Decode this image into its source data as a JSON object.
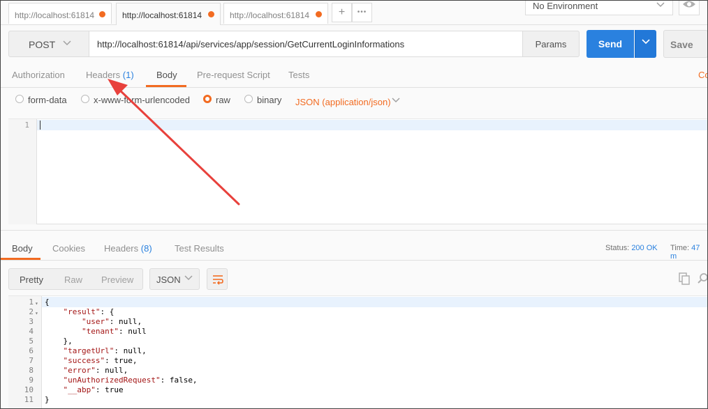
{
  "tabs": [
    {
      "label": "http://localhost:61814",
      "active": false,
      "unsaved": true
    },
    {
      "label": "http://localhost:61814",
      "active": true,
      "unsaved": true
    },
    {
      "label": "http://localhost:61814",
      "active": false,
      "unsaved": true
    }
  ],
  "tab_actions": {
    "add": "+",
    "more": "•••"
  },
  "environment": {
    "selected": "No Environment"
  },
  "request": {
    "method": "POST",
    "url": "http://localhost:61814/api/services/app/session/GetCurrentLoginInformations",
    "params_label": "Params",
    "send_label": "Send",
    "save_label": "Save"
  },
  "request_tabs": {
    "authorization": "Authorization",
    "headers": "Headers",
    "headers_count": "(1)",
    "body": "Body",
    "prerequest": "Pre-request Script",
    "tests": "Tests",
    "cookies_cut": "Co"
  },
  "body_types": {
    "form_data": "form-data",
    "urlencoded": "x-www-form-urlencoded",
    "raw": "raw",
    "binary": "binary",
    "content_type": "JSON (application/json)",
    "selected": "raw"
  },
  "request_editor": {
    "line_numbers": [
      "1"
    ]
  },
  "response_tabs": {
    "body": "Body",
    "cookies": "Cookies",
    "headers": "Headers",
    "headers_count": "(8)",
    "test_results": "Test Results"
  },
  "response_status": {
    "status_label": "Status:",
    "status_value": "200 OK",
    "time_label": "Time:",
    "time_value": "47 m"
  },
  "response_view": {
    "pretty": "Pretty",
    "raw": "Raw",
    "preview": "Preview",
    "format": "JSON"
  },
  "response_body": {
    "lines": [
      {
        "n": "1",
        "fold": true,
        "text": "{"
      },
      {
        "n": "2",
        "fold": true,
        "text": "    \"result\": {"
      },
      {
        "n": "3",
        "fold": false,
        "text": "        \"user\": null,"
      },
      {
        "n": "4",
        "fold": false,
        "text": "        \"tenant\": null"
      },
      {
        "n": "5",
        "fold": false,
        "text": "    },"
      },
      {
        "n": "6",
        "fold": false,
        "text": "    \"targetUrl\": null,"
      },
      {
        "n": "7",
        "fold": false,
        "text": "    \"success\": true,"
      },
      {
        "n": "8",
        "fold": false,
        "text": "    \"error\": null,"
      },
      {
        "n": "9",
        "fold": false,
        "text": "    \"unAuthorizedRequest\": false,"
      },
      {
        "n": "10",
        "fold": false,
        "text": "    \"__abp\": true"
      },
      {
        "n": "11",
        "fold": false,
        "text": "}"
      }
    ]
  },
  "colors": {
    "accent": "#f26b21",
    "send": "#2a81df",
    "annotation_arrow": "#e8413c",
    "json_key": "#a31515"
  },
  "icons": {
    "environment_chevron": "chevron-down-icon",
    "eye": "eye-icon",
    "copy": "copy-icon",
    "search": "search-icon",
    "wrap": "wrap-lines-icon"
  }
}
